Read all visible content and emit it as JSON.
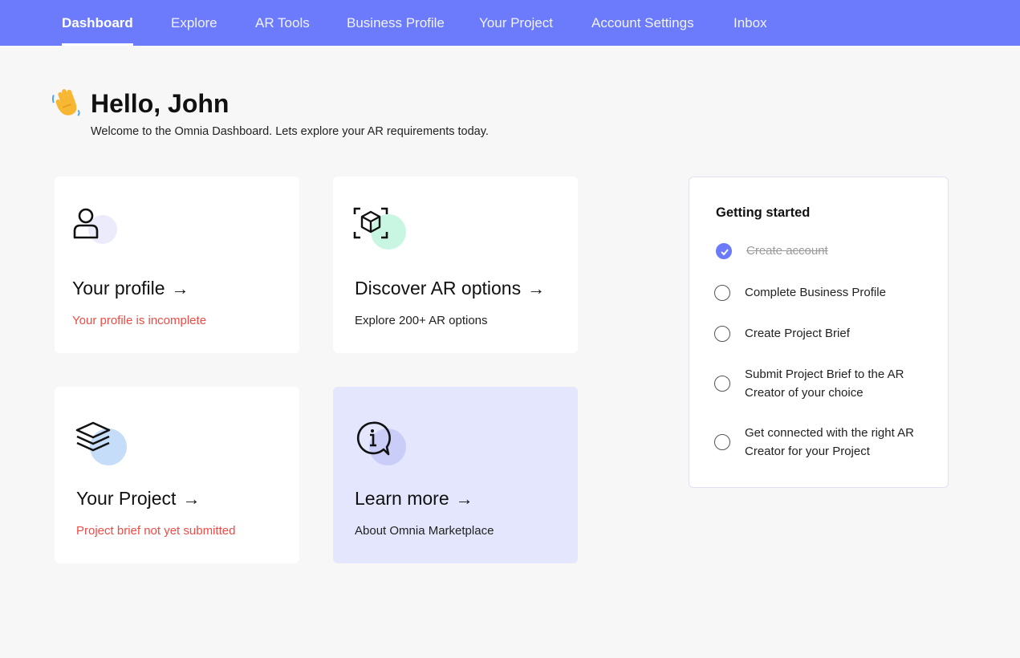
{
  "nav": {
    "items": [
      {
        "label": "Dashboard",
        "active": true
      },
      {
        "label": "Explore",
        "active": false
      },
      {
        "label": "AR Tools",
        "active": false
      },
      {
        "label": "Business Profile",
        "active": false
      },
      {
        "label": "Your Project",
        "active": false
      },
      {
        "label": "Account Settings",
        "active": false
      },
      {
        "label": "Inbox",
        "active": false
      }
    ]
  },
  "header": {
    "greeting_icon": "waving-hand-icon",
    "greeting": "Hello, John",
    "subtitle": "Welcome to the Omnia Dashboard. Lets explore your AR requirements today."
  },
  "cards": [
    {
      "title": "Your profile",
      "description": "Your profile is incomplete",
      "icon": "user-icon",
      "status": "warning"
    },
    {
      "title": "Discover AR options",
      "description": "Explore 200+ AR options",
      "icon": "ar-cube-icon",
      "status": "normal"
    },
    {
      "title": "Your Project",
      "description": "Project brief not yet submitted",
      "icon": "layers-icon",
      "status": "warning"
    },
    {
      "title": "Learn more",
      "description": "About Omnia Marketplace",
      "icon": "info-bubble-icon",
      "status": "normal"
    }
  ],
  "arrow_glyph": "→",
  "getting_started": {
    "title": "Getting started",
    "items": [
      {
        "label": "Create account",
        "done": true
      },
      {
        "label": "Complete Business Profile",
        "done": false
      },
      {
        "label": "Create Project Brief",
        "done": false
      },
      {
        "label": "Submit Project Brief to the AR Creator of your choice",
        "done": false
      },
      {
        "label": "Get connected with the right AR Creator for your Project",
        "done": false
      }
    ]
  },
  "colors": {
    "accent": "#6b7bfb",
    "warning": "#ef4b45",
    "background": "#f7f7f7",
    "highlight_card": "#e4e6fd"
  }
}
